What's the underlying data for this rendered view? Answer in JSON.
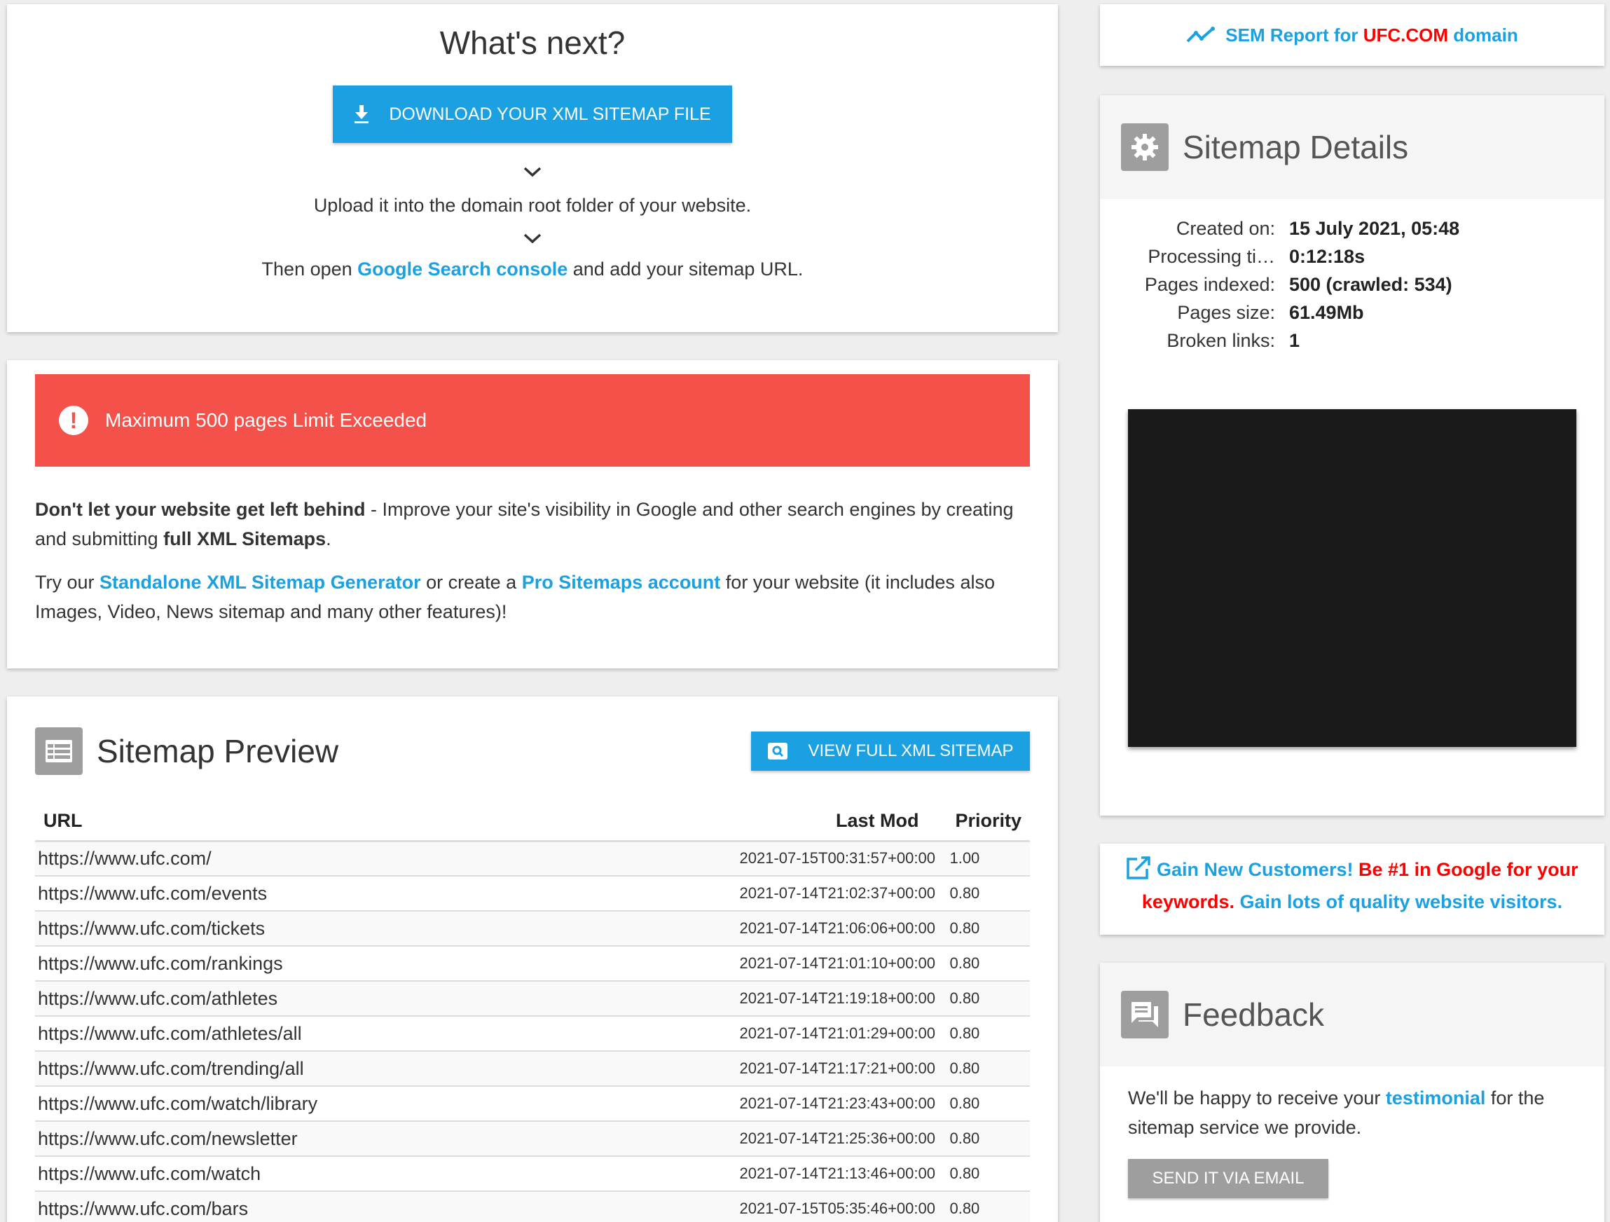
{
  "whats_next": {
    "title": "What's next?",
    "download_label": "DOWNLOAD YOUR XML SITEMAP FILE",
    "step1": "Upload it into the domain root folder of your website.",
    "step2_pre": "Then open ",
    "step2_link": "Google Search console",
    "step2_post": " and add your sitemap URL."
  },
  "alert": {
    "message": "Maximum 500 pages Limit Exceeded",
    "para1_bold": "Don't let your website get left behind",
    "para1_text": " - Improve your site's visibility in Google and other search engines by creating and submitting ",
    "para1_bold2": "full XML Sitemaps",
    "para1_end": ".",
    "para2_pre": "Try our ",
    "para2_link1": "Standalone XML Sitemap Generator",
    "para2_mid": " or create a ",
    "para2_link2": "Pro Sitemaps account",
    "para2_post": " for your website (it includes also Images, Video, News sitemap and many other features)!"
  },
  "preview": {
    "title": "Sitemap Preview",
    "view_label": "VIEW FULL XML SITEMAP",
    "columns": [
      "URL",
      "Last Mod",
      "Priority"
    ],
    "rows": [
      [
        "https://www.ufc.com/",
        "2021-07-15T00:31:57+00:00",
        "1.00"
      ],
      [
        "https://www.ufc.com/events",
        "2021-07-14T21:02:37+00:00",
        "0.80"
      ],
      [
        "https://www.ufc.com/tickets",
        "2021-07-14T21:06:06+00:00",
        "0.80"
      ],
      [
        "https://www.ufc.com/rankings",
        "2021-07-14T21:01:10+00:00",
        "0.80"
      ],
      [
        "https://www.ufc.com/athletes",
        "2021-07-14T21:19:18+00:00",
        "0.80"
      ],
      [
        "https://www.ufc.com/athletes/all",
        "2021-07-14T21:01:29+00:00",
        "0.80"
      ],
      [
        "https://www.ufc.com/trending/all",
        "2021-07-14T21:17:21+00:00",
        "0.80"
      ],
      [
        "https://www.ufc.com/watch/library",
        "2021-07-14T21:23:43+00:00",
        "0.80"
      ],
      [
        "https://www.ufc.com/newsletter",
        "2021-07-14T21:25:36+00:00",
        "0.80"
      ],
      [
        "https://www.ufc.com/watch",
        "2021-07-14T21:13:46+00:00",
        "0.80"
      ],
      [
        "https://www.ufc.com/bars",
        "2021-07-15T05:35:46+00:00",
        "0.80"
      ]
    ]
  },
  "sem": {
    "pre": "SEM Report for ",
    "domain": "UFC.COM",
    "post": " domain"
  },
  "details": {
    "title": "Sitemap Details",
    "rows": [
      {
        "label": "Created on:",
        "value": "15 July 2021, 05:48"
      },
      {
        "label": "Processing ti…",
        "value": "0:12:18s"
      },
      {
        "label": "Pages indexed:",
        "value": "500 (crawled: 534)"
      },
      {
        "label": "Pages size:",
        "value": "61.49Mb"
      },
      {
        "label": "Broken links:",
        "value": "1"
      }
    ]
  },
  "gain": {
    "part1": "Gain New Customers!",
    "part2": " Be #1 in Google for your keywords.",
    "part3": " Gain lots of quality website visitors."
  },
  "feedback": {
    "title": "Feedback",
    "text_pre": "We'll be happy to receive your ",
    "text_link": "testimonial",
    "text_post": " for the sitemap service we provide.",
    "button_label": "SEND IT VIA EMAIL"
  },
  "colors": {
    "accent": "#1ba1e2",
    "alert": "#f4514a",
    "highlight": "#ff0000",
    "icon_bg": "#9e9e9e"
  }
}
